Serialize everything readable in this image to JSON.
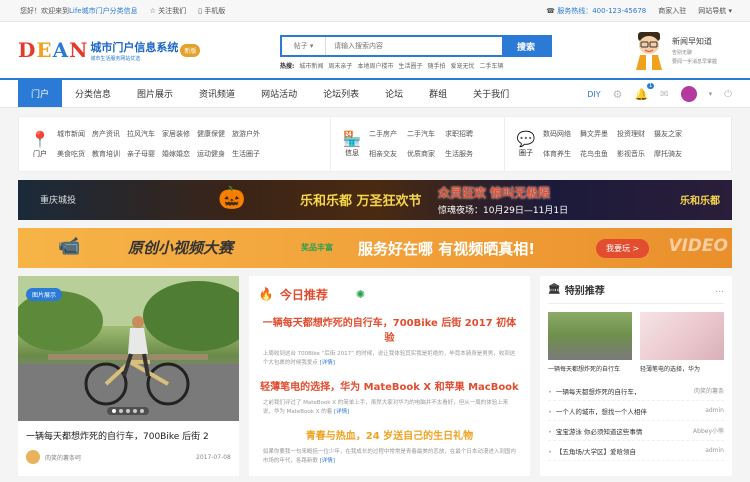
{
  "topbar": {
    "welcome": "您好！欢迎来到",
    "site": "Life城市门户分类信息",
    "follow": "关注我们",
    "mobile": "手机版",
    "hotline": "服务热线：400-123-45678",
    "merchant": "商家入驻",
    "sitenav": "网站导航"
  },
  "logo": {
    "word": "DEAN",
    "sub": "城市门户信息系统",
    "sub_small": "城市生活服务网站优选",
    "badge": "新版"
  },
  "search": {
    "category": "帖子",
    "placeholder": "请输入搜索内容",
    "button": "搜索",
    "hot_label": "热搜:",
    "hot": [
      "城市新闻",
      "周末亲子",
      "本地周户楼市",
      "生活圈子",
      "随手拍",
      "爱宠无忧",
      "二手车辆"
    ]
  },
  "promo": {
    "title": "新闻早知道",
    "line1": "告别无聊",
    "line2": "要闻一手消息早掌握"
  },
  "nav": {
    "items": [
      "门户",
      "分类信息",
      "图片展示",
      "资讯频道",
      "网站活动",
      "论坛列表",
      "论坛",
      "群组",
      "关于我们"
    ],
    "diy": "DIY",
    "badge": "1"
  },
  "categories": [
    {
      "label": "门户",
      "color": "#2a7ad6",
      "items": [
        "城市新闻",
        "房产资讯",
        "拉风汽车",
        "家居装修",
        "健康保健",
        "旅游户外",
        "美食吃货",
        "教育培训",
        "亲子母婴",
        "婚嫁婚恋",
        "运动健身",
        "生活圈子"
      ]
    },
    {
      "label": "信息",
      "color": "#2aa04c",
      "items": [
        "二手房产",
        "二手汽车",
        "求职招聘",
        "相亲交友",
        "优质商家",
        "生活服务"
      ]
    },
    {
      "label": "圈子",
      "color": "#e8813a",
      "items": [
        "数码网络",
        "舞文弄墨",
        "投资理财",
        "摄友之家",
        "体育养生",
        "花鸟虫鱼",
        "影视音乐",
        "摩托骑友"
      ]
    }
  ],
  "banner1": {
    "brand": "重庆城投",
    "title": "乐和乐都 万圣狂欢节",
    "slogan": "众灵狂欢 惊叫无极限",
    "date": "惊魂夜场：10月29日—11月1日",
    "logo": "乐和乐都"
  },
  "banner2": {
    "title": "原创小视频大赛",
    "mid": "奖品丰富",
    "slogan": "服务好在哪 有视频晒真相!",
    "button": "我要玩 >",
    "tail": "VIDEO"
  },
  "feature": {
    "tag": "图片展示",
    "caption": "一辆每天都想炸死的自行车，700Bike 后街 2",
    "author": "肉笑的薯条呵",
    "date": "2017-07-08"
  },
  "today": {
    "title": "今日推荐",
    "articles": [
      {
        "title": "一辆每天都想炸死的自行车，700Bike 后街 2017 初体验",
        "desc": "上周收到这台 700Bike “后街 2017” 的时候，说让我体验其实我是拒绝的，毕竟本骑身是男男，收到这个大包裹的时候我爱点",
        "more": "[详情]"
      },
      {
        "title": "轻薄笔电的选择，华为 MateBook X 和苹果 MacBook",
        "desc": "之前我们评过了 MateBook X 的简单上手，虽然大家对华为的电脑并不太看好，但从一周的体验上来说，华为 MateBook X 的着",
        "more": "[详情]"
      },
      {
        "title": "青春与热血，24 岁送自己的生日礼物",
        "desc": "如果你要我一句来概括一位少年，在我成长的过程中常常是青春最美的恋放，在最个日本动漫进入到国内市场的年代，各路新歌",
        "more": "[详情]"
      }
    ]
  },
  "special": {
    "title": "特别推荐",
    "more": "...",
    "thumbs": [
      "一辆每天都想炸死的自行车",
      "轻薄笔电的选择，华为"
    ],
    "list": [
      {
        "title": "一辆每天都想炸死的自行车，",
        "author": "肉笑的薯条"
      },
      {
        "title": "一个人的城市，想找一个人相伴",
        "author": "admin"
      },
      {
        "title": "宝宝游泳 你必须知道这些事情",
        "author": "Abbey小熊"
      },
      {
        "title": "【五角场/大学区】爱晗领自",
        "author": "admin"
      }
    ]
  }
}
